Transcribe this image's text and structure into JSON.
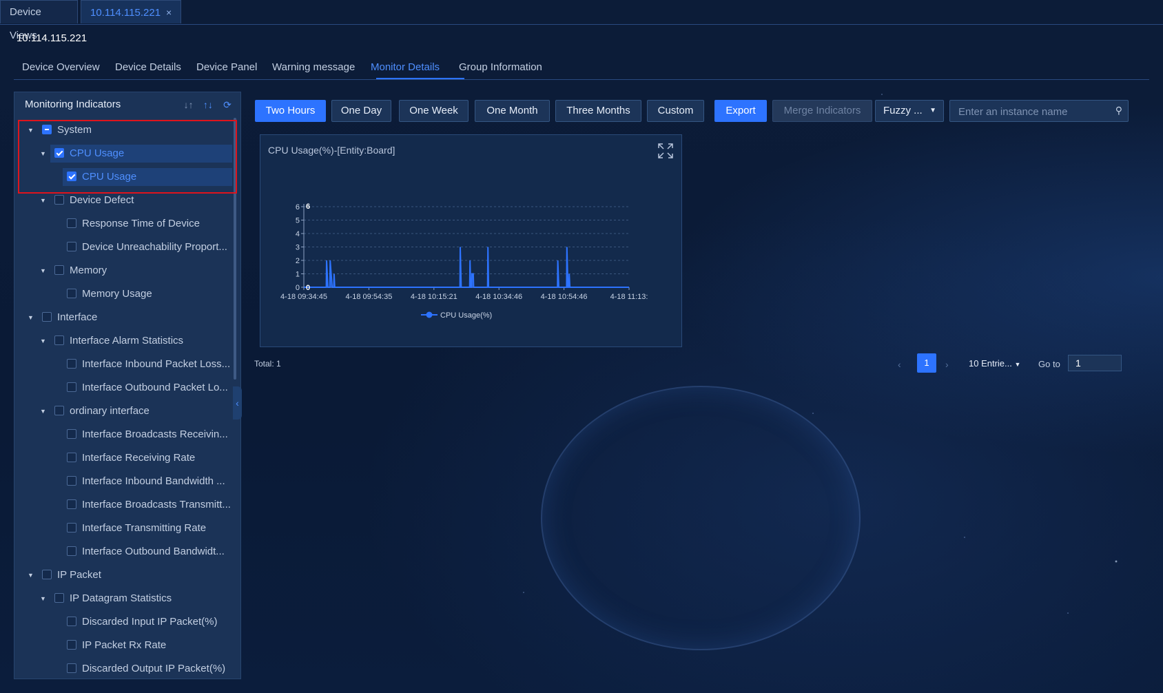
{
  "tabs": [
    {
      "label": "Device Views"
    },
    {
      "label": "10.114.115.221",
      "close": "×"
    }
  ],
  "device_title": "10.114.115.221",
  "subnav": [
    "Device Overview",
    "Device Details",
    "Device Panel",
    "Warning message",
    "Monitor Details",
    "Group Information"
  ],
  "active_subnav": "Monitor Details",
  "sidebar": {
    "title": "Monitoring Indicators",
    "icons": [
      "collapse-all-icon",
      "expand-all-icon",
      "refresh-icon"
    ],
    "tree": [
      {
        "label": "System",
        "level": 0,
        "expanded": true,
        "state": "partial"
      },
      {
        "label": "CPU Usage",
        "level": 1,
        "expanded": true,
        "state": "checked",
        "selected": true
      },
      {
        "label": "CPU Usage",
        "level": 2,
        "state": "checked",
        "selected": true
      },
      {
        "label": "Device Defect",
        "level": 1,
        "expanded": true,
        "state": "unchecked"
      },
      {
        "label": "Response Time of Device",
        "level": 2,
        "state": "unchecked"
      },
      {
        "label": "Device Unreachability Proport...",
        "level": 2,
        "state": "unchecked"
      },
      {
        "label": "Memory",
        "level": 1,
        "expanded": true,
        "state": "unchecked"
      },
      {
        "label": "Memory Usage",
        "level": 2,
        "state": "unchecked"
      },
      {
        "label": "Interface",
        "level": 0,
        "expanded": true,
        "state": "unchecked"
      },
      {
        "label": "Interface Alarm Statistics",
        "level": 1,
        "expanded": true,
        "state": "unchecked"
      },
      {
        "label": "Interface Inbound Packet Loss...",
        "level": 2,
        "state": "unchecked"
      },
      {
        "label": "Interface Outbound Packet Lo...",
        "level": 2,
        "state": "unchecked"
      },
      {
        "label": "ordinary interface",
        "level": 1,
        "expanded": true,
        "state": "unchecked"
      },
      {
        "label": "Interface Broadcasts Receivin...",
        "level": 2,
        "state": "unchecked"
      },
      {
        "label": "Interface Receiving Rate",
        "level": 2,
        "state": "unchecked"
      },
      {
        "label": "Interface Inbound Bandwidth ...",
        "level": 2,
        "state": "unchecked"
      },
      {
        "label": "Interface Broadcasts Transmitt...",
        "level": 2,
        "state": "unchecked"
      },
      {
        "label": "Interface Transmitting Rate",
        "level": 2,
        "state": "unchecked"
      },
      {
        "label": "Interface Outbound Bandwidt...",
        "level": 2,
        "state": "unchecked"
      },
      {
        "label": "IP Packet",
        "level": 0,
        "expanded": true,
        "state": "unchecked"
      },
      {
        "label": "IP Datagram Statistics",
        "level": 1,
        "expanded": true,
        "state": "unchecked"
      },
      {
        "label": "Discarded Input IP Packet(%)",
        "level": 2,
        "state": "unchecked"
      },
      {
        "label": "IP Packet Rx Rate",
        "level": 2,
        "state": "unchecked"
      },
      {
        "label": "Discarded Output IP Packet(%)",
        "level": 2,
        "state": "unchecked"
      }
    ]
  },
  "toolbar": {
    "ranges": [
      "Two Hours",
      "One Day",
      "One Week",
      "One Month",
      "Three Months",
      "Custom"
    ],
    "active_range": "Two Hours",
    "export": "Export",
    "merge": "Merge Indicators",
    "fuzzy": "Fuzzy ...",
    "search_placeholder": "Enter an instance name"
  },
  "card": {
    "title": "CPU Usage(%)-[Entity:Board]"
  },
  "chart_data": {
    "type": "line",
    "title": "CPU Usage(%)-[Entity:Board]",
    "x_ticks": [
      "4-18 09:34:45",
      "4-18 09:54:35",
      "4-18 10:15:21",
      "4-18 10:34:46",
      "4-18 10:54:46",
      "4-18 11:13:"
    ],
    "y_ticks": [
      0,
      1,
      2,
      3,
      4,
      5,
      6
    ],
    "ylim": [
      0,
      6
    ],
    "y_max_label": "6",
    "y_min_label": "0",
    "series": [
      {
        "name": "CPU Usage(%)",
        "color": "#2d73ff",
        "points": [
          [
            0.0,
            0
          ],
          [
            0.069,
            0
          ],
          [
            0.07,
            2
          ],
          [
            0.074,
            0
          ],
          [
            0.08,
            0
          ],
          [
            0.081,
            2
          ],
          [
            0.084,
            1
          ],
          [
            0.087,
            0
          ],
          [
            0.092,
            0
          ],
          [
            0.093,
            1
          ],
          [
            0.095,
            0
          ],
          [
            0.48,
            0
          ],
          [
            0.481,
            3
          ],
          [
            0.484,
            0
          ],
          [
            0.51,
            0
          ],
          [
            0.511,
            2
          ],
          [
            0.513,
            0
          ],
          [
            0.516,
            0
          ],
          [
            0.517,
            1
          ],
          [
            0.521,
            1
          ],
          [
            0.522,
            0
          ],
          [
            0.565,
            0
          ],
          [
            0.566,
            3
          ],
          [
            0.568,
            0
          ],
          [
            0.78,
            0
          ],
          [
            0.781,
            2
          ],
          [
            0.784,
            0
          ],
          [
            0.808,
            0
          ],
          [
            0.809,
            3
          ],
          [
            0.812,
            0
          ],
          [
            0.815,
            0
          ],
          [
            0.816,
            1
          ],
          [
            0.818,
            0
          ],
          [
            1.0,
            0
          ]
        ]
      }
    ],
    "grid": true,
    "legend": "bottom-center"
  },
  "pagination": {
    "total": "Total: 1",
    "prev": "‹",
    "next": "›",
    "page": "1",
    "page_size": "10 Entrie...",
    "goto_label": "Go to",
    "goto_value": "1"
  }
}
